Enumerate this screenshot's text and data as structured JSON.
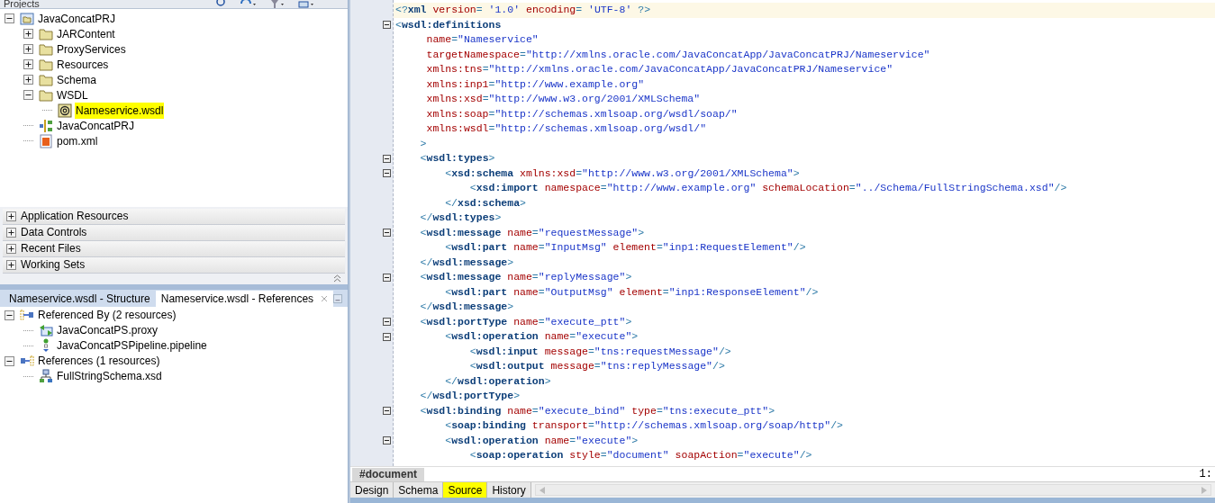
{
  "projects": {
    "title": "Projects",
    "tree": [
      {
        "label": "JavaConcatPRJ",
        "kind": "project",
        "expanded": true,
        "selected": false,
        "children": [
          {
            "label": "JARContent",
            "kind": "folder",
            "expanded": false,
            "selected": false
          },
          {
            "label": "ProxyServices",
            "kind": "folder",
            "expanded": false,
            "selected": false
          },
          {
            "label": "Resources",
            "kind": "folder",
            "expanded": false,
            "selected": false
          },
          {
            "label": "Schema",
            "kind": "folder",
            "expanded": false,
            "selected": false
          },
          {
            "label": "WSDL",
            "kind": "folder",
            "expanded": true,
            "selected": false,
            "children": [
              {
                "label": "Nameservice.wsdl",
                "kind": "wsdl",
                "selected": true
              }
            ]
          },
          {
            "label": "JavaConcatPRJ",
            "kind": "jpr",
            "selected": false
          },
          {
            "label": "pom.xml",
            "kind": "maven",
            "selected": false
          }
        ]
      }
    ]
  },
  "accordion": [
    {
      "label": "Application Resources",
      "expanded": false
    },
    {
      "label": "Data Controls",
      "expanded": false
    },
    {
      "label": "Recent Files",
      "expanded": false
    },
    {
      "label": "Working Sets",
      "expanded": false
    }
  ],
  "bottom_panel": {
    "tabs": [
      {
        "label": "Nameservice.wsdl - Structure",
        "selected": false
      },
      {
        "label": "Nameservice.wsdl - References",
        "selected": true
      }
    ],
    "tree": [
      {
        "label": "Referenced By (2 resources)",
        "kind": "referenced",
        "expanded": true,
        "selected": false,
        "children": [
          {
            "label": "JavaConcatPS.proxy",
            "kind": "proxy",
            "selected": false
          },
          {
            "label": "JavaConcatPSPipeline.pipeline",
            "kind": "pipeline",
            "selected": false
          }
        ]
      },
      {
        "label": "References (1 resources)",
        "kind": "references",
        "expanded": true,
        "selected": false,
        "children": [
          {
            "label": "FullStringSchema.xsd",
            "kind": "schema",
            "selected": false
          }
        ]
      }
    ]
  },
  "editor": {
    "lines": [
      {
        "current": true,
        "fold": false,
        "segments": [
          {
            "kind": "punct",
            "text": "<?"
          },
          {
            "kind": "tag",
            "text": "xml"
          },
          {
            "kind": "attr",
            "text": " version"
          },
          {
            "kind": "punct",
            "text": "= "
          },
          {
            "kind": "value",
            "text": "'1.0'"
          },
          {
            "kind": "attr",
            "text": " encoding"
          },
          {
            "kind": "punct",
            "text": "= "
          },
          {
            "kind": "value",
            "text": "'UTF-8'"
          },
          {
            "kind": "punct",
            "text": " ?>"
          }
        ]
      },
      {
        "current": false,
        "fold": true,
        "segments": [
          {
            "kind": "punct",
            "text": "<"
          },
          {
            "kind": "tag",
            "text": "wsdl:definitions"
          }
        ]
      },
      {
        "current": false,
        "fold": false,
        "segments": [
          {
            "kind": "attr",
            "text": "     name"
          },
          {
            "kind": "punct",
            "text": "="
          },
          {
            "kind": "value",
            "text": "\"Nameservice\""
          }
        ]
      },
      {
        "current": false,
        "fold": false,
        "segments": [
          {
            "kind": "attr",
            "text": "     targetNamespace"
          },
          {
            "kind": "punct",
            "text": "="
          },
          {
            "kind": "value",
            "text": "\"http://xmlns.oracle.com/JavaConcatApp/JavaConcatPRJ/Nameservice\""
          }
        ]
      },
      {
        "current": false,
        "fold": false,
        "segments": [
          {
            "kind": "attr",
            "text": "     xmlns:tns"
          },
          {
            "kind": "punct",
            "text": "="
          },
          {
            "kind": "value",
            "text": "\"http://xmlns.oracle.com/JavaConcatApp/JavaConcatPRJ/Nameservice\""
          }
        ]
      },
      {
        "current": false,
        "fold": false,
        "segments": [
          {
            "kind": "attr",
            "text": "     xmlns:inp1"
          },
          {
            "kind": "punct",
            "text": "="
          },
          {
            "kind": "value",
            "text": "\"http://www.example.org\""
          }
        ]
      },
      {
        "current": false,
        "fold": false,
        "segments": [
          {
            "kind": "attr",
            "text": "     xmlns:xsd"
          },
          {
            "kind": "punct",
            "text": "="
          },
          {
            "kind": "value",
            "text": "\"http://www.w3.org/2001/XMLSchema\""
          }
        ]
      },
      {
        "current": false,
        "fold": false,
        "segments": [
          {
            "kind": "attr",
            "text": "     xmlns:soap"
          },
          {
            "kind": "punct",
            "text": "="
          },
          {
            "kind": "value",
            "text": "\"http://schemas.xmlsoap.org/wsdl/soap/\""
          }
        ]
      },
      {
        "current": false,
        "fold": false,
        "segments": [
          {
            "kind": "attr",
            "text": "     xmlns:wsdl"
          },
          {
            "kind": "punct",
            "text": "="
          },
          {
            "kind": "value",
            "text": "\"http://schemas.xmlsoap.org/wsdl/\""
          }
        ]
      },
      {
        "current": false,
        "fold": false,
        "segments": [
          {
            "kind": "punct",
            "text": "    >"
          }
        ]
      },
      {
        "current": false,
        "fold": true,
        "segments": [
          {
            "kind": "punct",
            "text": "    <"
          },
          {
            "kind": "tag",
            "text": "wsdl:types"
          },
          {
            "kind": "punct",
            "text": ">"
          }
        ]
      },
      {
        "current": false,
        "fold": true,
        "segments": [
          {
            "kind": "punct",
            "text": "        <"
          },
          {
            "kind": "tag",
            "text": "xsd:schema"
          },
          {
            "kind": "attr",
            "text": " xmlns:xsd"
          },
          {
            "kind": "punct",
            "text": "="
          },
          {
            "kind": "value",
            "text": "\"http://www.w3.org/2001/XMLSchema\""
          },
          {
            "kind": "punct",
            "text": ">"
          }
        ]
      },
      {
        "current": false,
        "fold": false,
        "segments": [
          {
            "kind": "punct",
            "text": "            <"
          },
          {
            "kind": "tag",
            "text": "xsd:import"
          },
          {
            "kind": "attr",
            "text": " namespace"
          },
          {
            "kind": "punct",
            "text": "="
          },
          {
            "kind": "value",
            "text": "\"http://www.example.org\""
          },
          {
            "kind": "attr",
            "text": " schemaLocation"
          },
          {
            "kind": "punct",
            "text": "="
          },
          {
            "kind": "value",
            "text": "\"../Schema/FullStringSchema.xsd\""
          },
          {
            "kind": "punct",
            "text": "/>"
          }
        ]
      },
      {
        "current": false,
        "fold": false,
        "segments": [
          {
            "kind": "punct",
            "text": "        </"
          },
          {
            "kind": "tag",
            "text": "xsd:schema"
          },
          {
            "kind": "punct",
            "text": ">"
          }
        ]
      },
      {
        "current": false,
        "fold": false,
        "segments": [
          {
            "kind": "punct",
            "text": "    </"
          },
          {
            "kind": "tag",
            "text": "wsdl:types"
          },
          {
            "kind": "punct",
            "text": ">"
          }
        ]
      },
      {
        "current": false,
        "fold": true,
        "segments": [
          {
            "kind": "punct",
            "text": "    <"
          },
          {
            "kind": "tag",
            "text": "wsdl:message"
          },
          {
            "kind": "attr",
            "text": " name"
          },
          {
            "kind": "punct",
            "text": "="
          },
          {
            "kind": "value",
            "text": "\"requestMessage\""
          },
          {
            "kind": "punct",
            "text": ">"
          }
        ]
      },
      {
        "current": false,
        "fold": false,
        "segments": [
          {
            "kind": "punct",
            "text": "        <"
          },
          {
            "kind": "tag",
            "text": "wsdl:part"
          },
          {
            "kind": "attr",
            "text": " name"
          },
          {
            "kind": "punct",
            "text": "="
          },
          {
            "kind": "value",
            "text": "\"InputMsg\""
          },
          {
            "kind": "attr",
            "text": " element"
          },
          {
            "kind": "punct",
            "text": "="
          },
          {
            "kind": "value",
            "text": "\"inp1:RequestElement\""
          },
          {
            "kind": "punct",
            "text": "/>"
          }
        ]
      },
      {
        "current": false,
        "fold": false,
        "segments": [
          {
            "kind": "punct",
            "text": "    </"
          },
          {
            "kind": "tag",
            "text": "wsdl:message"
          },
          {
            "kind": "punct",
            "text": ">"
          }
        ]
      },
      {
        "current": false,
        "fold": true,
        "segments": [
          {
            "kind": "punct",
            "text": "    <"
          },
          {
            "kind": "tag",
            "text": "wsdl:message"
          },
          {
            "kind": "attr",
            "text": " name"
          },
          {
            "kind": "punct",
            "text": "="
          },
          {
            "kind": "value",
            "text": "\"replyMessage\""
          },
          {
            "kind": "punct",
            "text": ">"
          }
        ]
      },
      {
        "current": false,
        "fold": false,
        "segments": [
          {
            "kind": "punct",
            "text": "        <"
          },
          {
            "kind": "tag",
            "text": "wsdl:part"
          },
          {
            "kind": "attr",
            "text": " name"
          },
          {
            "kind": "punct",
            "text": "="
          },
          {
            "kind": "value",
            "text": "\"OutputMsg\""
          },
          {
            "kind": "attr",
            "text": " element"
          },
          {
            "kind": "punct",
            "text": "="
          },
          {
            "kind": "value",
            "text": "\"inp1:ResponseElement\""
          },
          {
            "kind": "punct",
            "text": "/>"
          }
        ]
      },
      {
        "current": false,
        "fold": false,
        "segments": [
          {
            "kind": "punct",
            "text": "    </"
          },
          {
            "kind": "tag",
            "text": "wsdl:message"
          },
          {
            "kind": "punct",
            "text": ">"
          }
        ]
      },
      {
        "current": false,
        "fold": true,
        "segments": [
          {
            "kind": "punct",
            "text": "    <"
          },
          {
            "kind": "tag",
            "text": "wsdl:portType"
          },
          {
            "kind": "attr",
            "text": " name"
          },
          {
            "kind": "punct",
            "text": "="
          },
          {
            "kind": "value",
            "text": "\"execute_ptt\""
          },
          {
            "kind": "punct",
            "text": ">"
          }
        ]
      },
      {
        "current": false,
        "fold": true,
        "segments": [
          {
            "kind": "punct",
            "text": "        <"
          },
          {
            "kind": "tag",
            "text": "wsdl:operation"
          },
          {
            "kind": "attr",
            "text": " name"
          },
          {
            "kind": "punct",
            "text": "="
          },
          {
            "kind": "value",
            "text": "\"execute\""
          },
          {
            "kind": "punct",
            "text": ">"
          }
        ]
      },
      {
        "current": false,
        "fold": false,
        "segments": [
          {
            "kind": "punct",
            "text": "            <"
          },
          {
            "kind": "tag",
            "text": "wsdl:input"
          },
          {
            "kind": "attr",
            "text": " message"
          },
          {
            "kind": "punct",
            "text": "="
          },
          {
            "kind": "value",
            "text": "\"tns:requestMessage\""
          },
          {
            "kind": "punct",
            "text": "/>"
          }
        ]
      },
      {
        "current": false,
        "fold": false,
        "segments": [
          {
            "kind": "punct",
            "text": "            <"
          },
          {
            "kind": "tag",
            "text": "wsdl:output"
          },
          {
            "kind": "attr",
            "text": " message"
          },
          {
            "kind": "punct",
            "text": "="
          },
          {
            "kind": "value",
            "text": "\"tns:replyMessage\""
          },
          {
            "kind": "punct",
            "text": "/>"
          }
        ]
      },
      {
        "current": false,
        "fold": false,
        "segments": [
          {
            "kind": "punct",
            "text": "        </"
          },
          {
            "kind": "tag",
            "text": "wsdl:operation"
          },
          {
            "kind": "punct",
            "text": ">"
          }
        ]
      },
      {
        "current": false,
        "fold": false,
        "segments": [
          {
            "kind": "punct",
            "text": "    </"
          },
          {
            "kind": "tag",
            "text": "wsdl:portType"
          },
          {
            "kind": "punct",
            "text": ">"
          }
        ]
      },
      {
        "current": false,
        "fold": true,
        "segments": [
          {
            "kind": "punct",
            "text": "    <"
          },
          {
            "kind": "tag",
            "text": "wsdl:binding"
          },
          {
            "kind": "attr",
            "text": " name"
          },
          {
            "kind": "punct",
            "text": "="
          },
          {
            "kind": "value",
            "text": "\"execute_bind\""
          },
          {
            "kind": "attr",
            "text": " type"
          },
          {
            "kind": "punct",
            "text": "="
          },
          {
            "kind": "value",
            "text": "\"tns:execute_ptt\""
          },
          {
            "kind": "punct",
            "text": ">"
          }
        ]
      },
      {
        "current": false,
        "fold": false,
        "segments": [
          {
            "kind": "punct",
            "text": "        <"
          },
          {
            "kind": "tag",
            "text": "soap:binding"
          },
          {
            "kind": "attr",
            "text": " transport"
          },
          {
            "kind": "punct",
            "text": "="
          },
          {
            "kind": "value",
            "text": "\"http://schemas.xmlsoap.org/soap/http\""
          },
          {
            "kind": "punct",
            "text": "/>"
          }
        ]
      },
      {
        "current": false,
        "fold": true,
        "segments": [
          {
            "kind": "punct",
            "text": "        <"
          },
          {
            "kind": "tag",
            "text": "wsdl:operation"
          },
          {
            "kind": "attr",
            "text": " name"
          },
          {
            "kind": "punct",
            "text": "="
          },
          {
            "kind": "value",
            "text": "\"execute\""
          },
          {
            "kind": "punct",
            "text": ">"
          }
        ]
      },
      {
        "current": false,
        "fold": false,
        "segments": [
          {
            "kind": "punct",
            "text": "            <"
          },
          {
            "kind": "tag",
            "text": "soap:operation"
          },
          {
            "kind": "attr",
            "text": " style"
          },
          {
            "kind": "punct",
            "text": "="
          },
          {
            "kind": "value",
            "text": "\"document\""
          },
          {
            "kind": "attr",
            "text": " soapAction"
          },
          {
            "kind": "punct",
            "text": "="
          },
          {
            "kind": "value",
            "text": "\"execute\""
          },
          {
            "kind": "punct",
            "text": "/>"
          }
        ]
      }
    ],
    "breadcrumb": "#document",
    "position": "1:",
    "tabs": [
      {
        "label": "Design",
        "selected": false
      },
      {
        "label": "Schema",
        "selected": false
      },
      {
        "label": "Source",
        "selected": true
      },
      {
        "label": "History",
        "selected": false
      }
    ]
  }
}
